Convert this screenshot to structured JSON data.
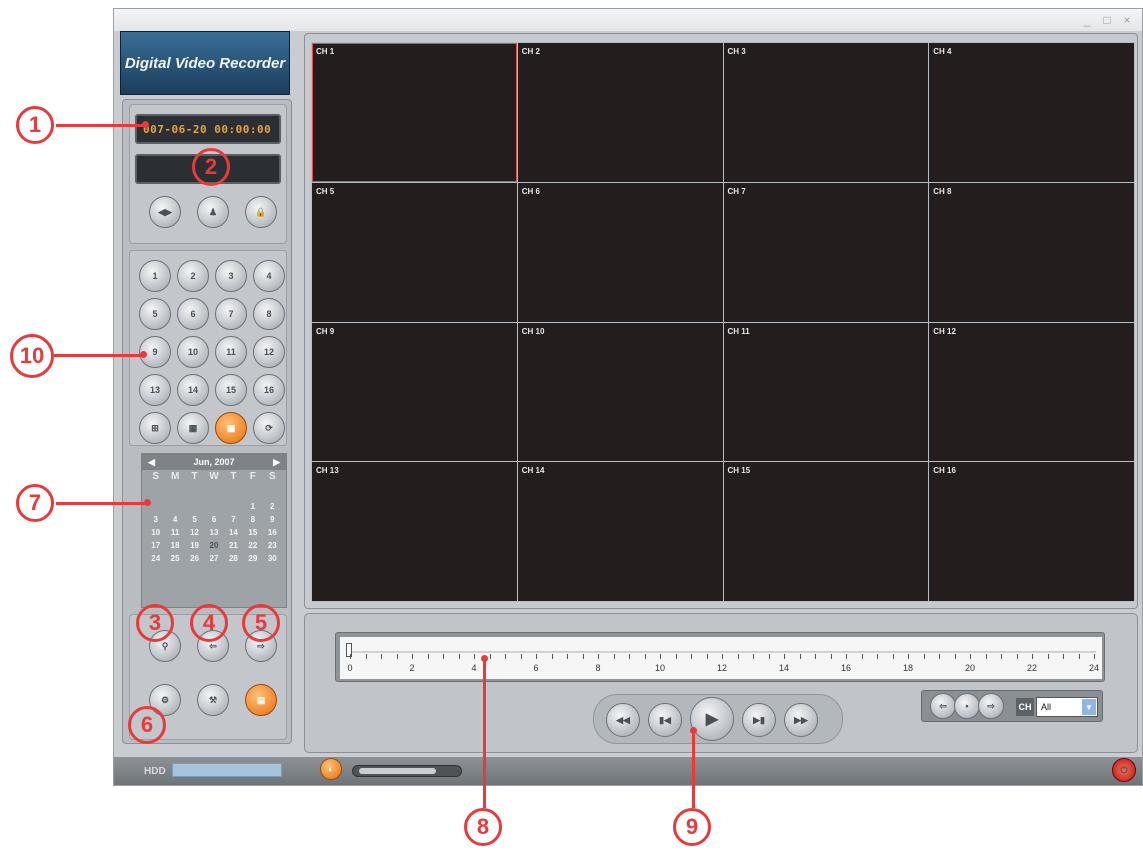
{
  "window": {
    "app_title": "Digital Video Recorder",
    "controls": {
      "minimize": "_",
      "maximize": "□",
      "close": "×"
    }
  },
  "left_panel": {
    "datetime": "007-06-20 00:00:00",
    "top_buttons": [
      {
        "icon": "arrows-icon",
        "glyph": "◀▶"
      },
      {
        "icon": "user-icon",
        "glyph": "♟"
      },
      {
        "icon": "lock-icon",
        "glyph": "🔒"
      }
    ],
    "channel_buttons": [
      "1",
      "2",
      "3",
      "4",
      "5",
      "6",
      "7",
      "8",
      "9",
      "10",
      "11",
      "12",
      "13",
      "14",
      "15",
      "16"
    ],
    "layout_buttons": [
      {
        "icon": "layout-4-icon",
        "glyph": "⊞"
      },
      {
        "icon": "layout-9-icon",
        "glyph": "▦"
      },
      {
        "icon": "layout-16-icon",
        "glyph": "▦"
      },
      {
        "icon": "cycle-icon",
        "glyph": "⟳"
      }
    ],
    "calendar": {
      "month": "Jun, 2007",
      "weekdays": [
        "S",
        "M",
        "T",
        "W",
        "T",
        "F",
        "S"
      ],
      "days": [
        "",
        "",
        "",
        "",
        "",
        "1",
        "2",
        "3",
        "4",
        "5",
        "6",
        "7",
        "8",
        "9",
        "10",
        "11",
        "12",
        "13",
        "14",
        "15",
        "16",
        "17",
        "18",
        "19",
        "20",
        "21",
        "22",
        "23",
        "24",
        "25",
        "26",
        "27",
        "28",
        "29",
        "30"
      ],
      "selected": "20"
    },
    "function_buttons": [
      {
        "icon": "search-icon",
        "glyph": "⚲"
      },
      {
        "icon": "export-icon",
        "glyph": "⇦"
      },
      {
        "icon": "backup-icon",
        "glyph": "⇨"
      },
      {
        "icon": "config-icon",
        "glyph": "⚙"
      },
      {
        "icon": "tools-icon",
        "glyph": "⚒"
      },
      {
        "icon": "log-icon",
        "glyph": "▤"
      }
    ]
  },
  "channels": [
    "CH 1",
    "CH 2",
    "CH 3",
    "CH 4",
    "CH 5",
    "CH 6",
    "CH 7",
    "CH 8",
    "CH 9",
    "CH 10",
    "CH 11",
    "CH 12",
    "CH 13",
    "CH 14",
    "CH 15",
    "CH 16"
  ],
  "timeline": {
    "labels": [
      "0",
      "2",
      "4",
      "6",
      "8",
      "10",
      "12",
      "14",
      "16",
      "18",
      "20",
      "22",
      "24"
    ]
  },
  "transport": [
    {
      "icon": "rewind-icon",
      "glyph": "◀◀"
    },
    {
      "icon": "step-back-icon",
      "glyph": "▮◀"
    },
    {
      "icon": "play-icon",
      "glyph": "▶"
    },
    {
      "icon": "step-forward-icon",
      "glyph": "▶▮"
    },
    {
      "icon": "fast-forward-icon",
      "glyph": "▶▶"
    }
  ],
  "channel_select": {
    "label": "CH",
    "value": "All",
    "nav": [
      "⇦",
      "⇨"
    ]
  },
  "status": {
    "hdd_label": "HDD",
    "volume": 0.8
  },
  "callouts": [
    "1",
    "2",
    "3",
    "4",
    "5",
    "6",
    "7",
    "8",
    "9",
    "10"
  ]
}
